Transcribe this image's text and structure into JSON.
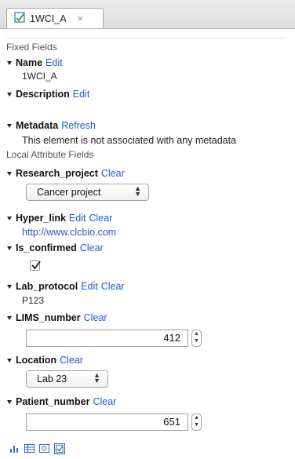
{
  "tab": {
    "title": "1WCI_A",
    "close_symbol": "×",
    "icon": "sequence-doc-icon"
  },
  "sections": {
    "fixed": "Fixed Fields",
    "local": "Local Attribute Fields"
  },
  "fields": {
    "name": {
      "label": "Name",
      "edit": "Edit",
      "value": "1WCI_A"
    },
    "description": {
      "label": "Description",
      "edit": "Edit"
    },
    "metadata": {
      "label": "Metadata",
      "refresh": "Refresh",
      "message": "This element is not associated with any metadata"
    },
    "research_project": {
      "label": "Research_project",
      "clear": "Clear",
      "selected": "Cancer project"
    },
    "hyper_link": {
      "label": "Hyper_link",
      "edit": "Edit",
      "clear": "Clear",
      "value": "http://www.clcbio.com"
    },
    "is_confirmed": {
      "label": "Is_confirmed",
      "clear": "Clear",
      "checked": true
    },
    "lab_protocol": {
      "label": "Lab_protocol",
      "edit": "Edit",
      "clear": "Clear",
      "value": "P123"
    },
    "lims_number": {
      "label": "LIMS_number",
      "clear": "Clear",
      "value": "412"
    },
    "location": {
      "label": "Location",
      "clear": "Clear",
      "selected": "Lab 23"
    },
    "patient_number": {
      "label": "Patient_number",
      "clear": "Clear",
      "value": "651"
    }
  },
  "footer_icons": [
    "bar-chart-icon",
    "table-icon",
    "graphic-view-icon",
    "element-info-icon"
  ],
  "colors": {
    "link": "#1f5bd3",
    "accent_icon": "#1f6fc7"
  }
}
